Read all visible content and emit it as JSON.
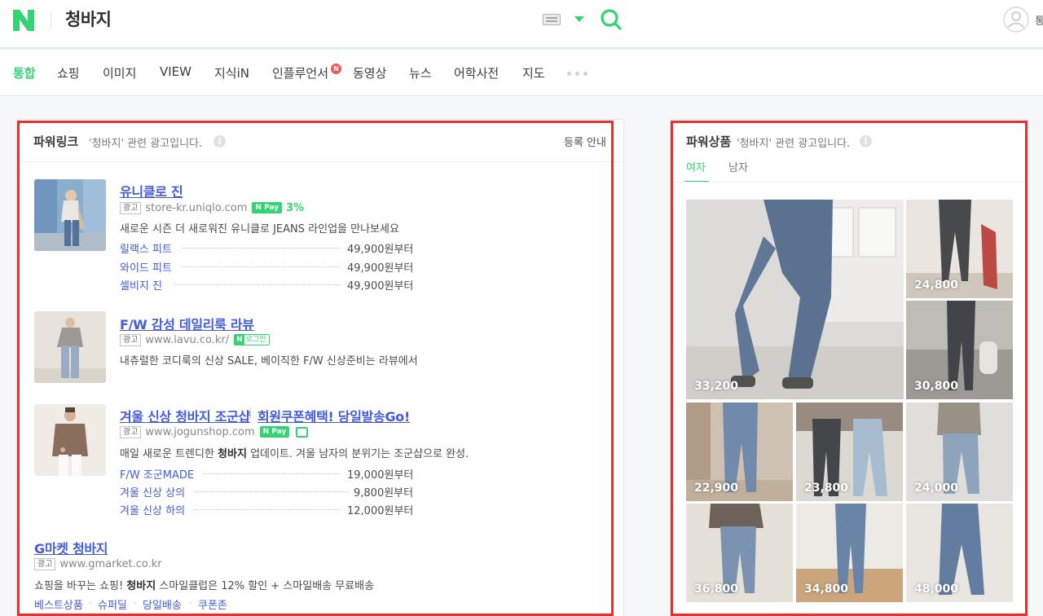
{
  "header": {
    "query": "청바지",
    "user_truncated": "통"
  },
  "nav": {
    "tabs": [
      {
        "label": "통합",
        "active": true
      },
      {
        "label": "쇼핑"
      },
      {
        "label": "이미지"
      },
      {
        "label": "VIEW"
      },
      {
        "label": "지식iN"
      },
      {
        "label": "인플루언서",
        "badge": "N"
      },
      {
        "label": "동영상"
      },
      {
        "label": "뉴스"
      },
      {
        "label": "어학사전"
      },
      {
        "label": "지도"
      }
    ]
  },
  "powerlink": {
    "title": "파워링크",
    "subtitle": "'청바지' 관련 광고입니다.",
    "register_guide": "등록 안내",
    "ad_label": "광고",
    "ads": [
      {
        "title": "유니클로 진",
        "url": "store-kr.uniqlo.com",
        "npay": "Pay",
        "npay_rate": "3%",
        "desc": "새로운 시즌 더 새로워진 유니클로 JEANS 라인업을 만나보세요",
        "sublinks": [
          {
            "name": "릴랙스 피트",
            "price": "49,900원부터"
          },
          {
            "name": "와이드 피트",
            "price": "49,900원부터"
          },
          {
            "name": "셀비지 진",
            "price": "49,900원부터"
          }
        ]
      },
      {
        "title": "F/W 감성 데일리룩 라뷰",
        "url": "www.lavu.co.kr/",
        "nlogin": "로그인",
        "desc": "내츄럴한 코디룩의 신상 SALE, 베이직한 F/W 신상준비는 라뷰에서"
      },
      {
        "title": "겨울 신상 청바지 조군샵",
        "title_sep": "|",
        "title2": "회원쿠폰혜택! 당일발송Go!",
        "url": "www.jogunshop.com",
        "npay": "Pay",
        "desc_pre": "매일 새로운 트렌디한 ",
        "desc_bold": "청바지",
        "desc_post": " 업데이트. 겨울 남자의 분위기는 조군샵으로 완성.",
        "sublinks": [
          {
            "name": "F/W 조군MADE",
            "price": "19,000원부터"
          },
          {
            "name": "겨울 신상 상의",
            "price": "9,800원부터"
          },
          {
            "name": "겨울 신상 하의",
            "price": "12,000원부터"
          }
        ]
      },
      {
        "title": "G마켓 청바지",
        "url": "www.gmarket.co.kr",
        "desc_pre": "쇼핑을 바꾸는 쇼핑! ",
        "desc_bold": "청바지",
        "desc_post": " 스마일클럽은 12% 할인 + 스마일배송 무료배송",
        "links": [
          "베스트상품",
          "슈퍼딜",
          "당일배송",
          "쿠폰존"
        ]
      }
    ]
  },
  "powershop": {
    "title": "파워상품",
    "subtitle": "'청바지' 관련 광고입니다.",
    "tabs": [
      "여자",
      "남자"
    ],
    "active_tab": "여자",
    "products": [
      {
        "price": "33,200"
      },
      {
        "price": "24,800"
      },
      {
        "price": "30,800"
      },
      {
        "price": "22,900"
      },
      {
        "price": "23,800"
      },
      {
        "price": "24,000"
      },
      {
        "price": "36,800"
      },
      {
        "price": "34,800"
      },
      {
        "price": "48,000"
      }
    ]
  },
  "colors": {
    "naver_green": "#19ce60",
    "link_blue": "#2a45d8",
    "highlight_red": "#e8312f"
  }
}
